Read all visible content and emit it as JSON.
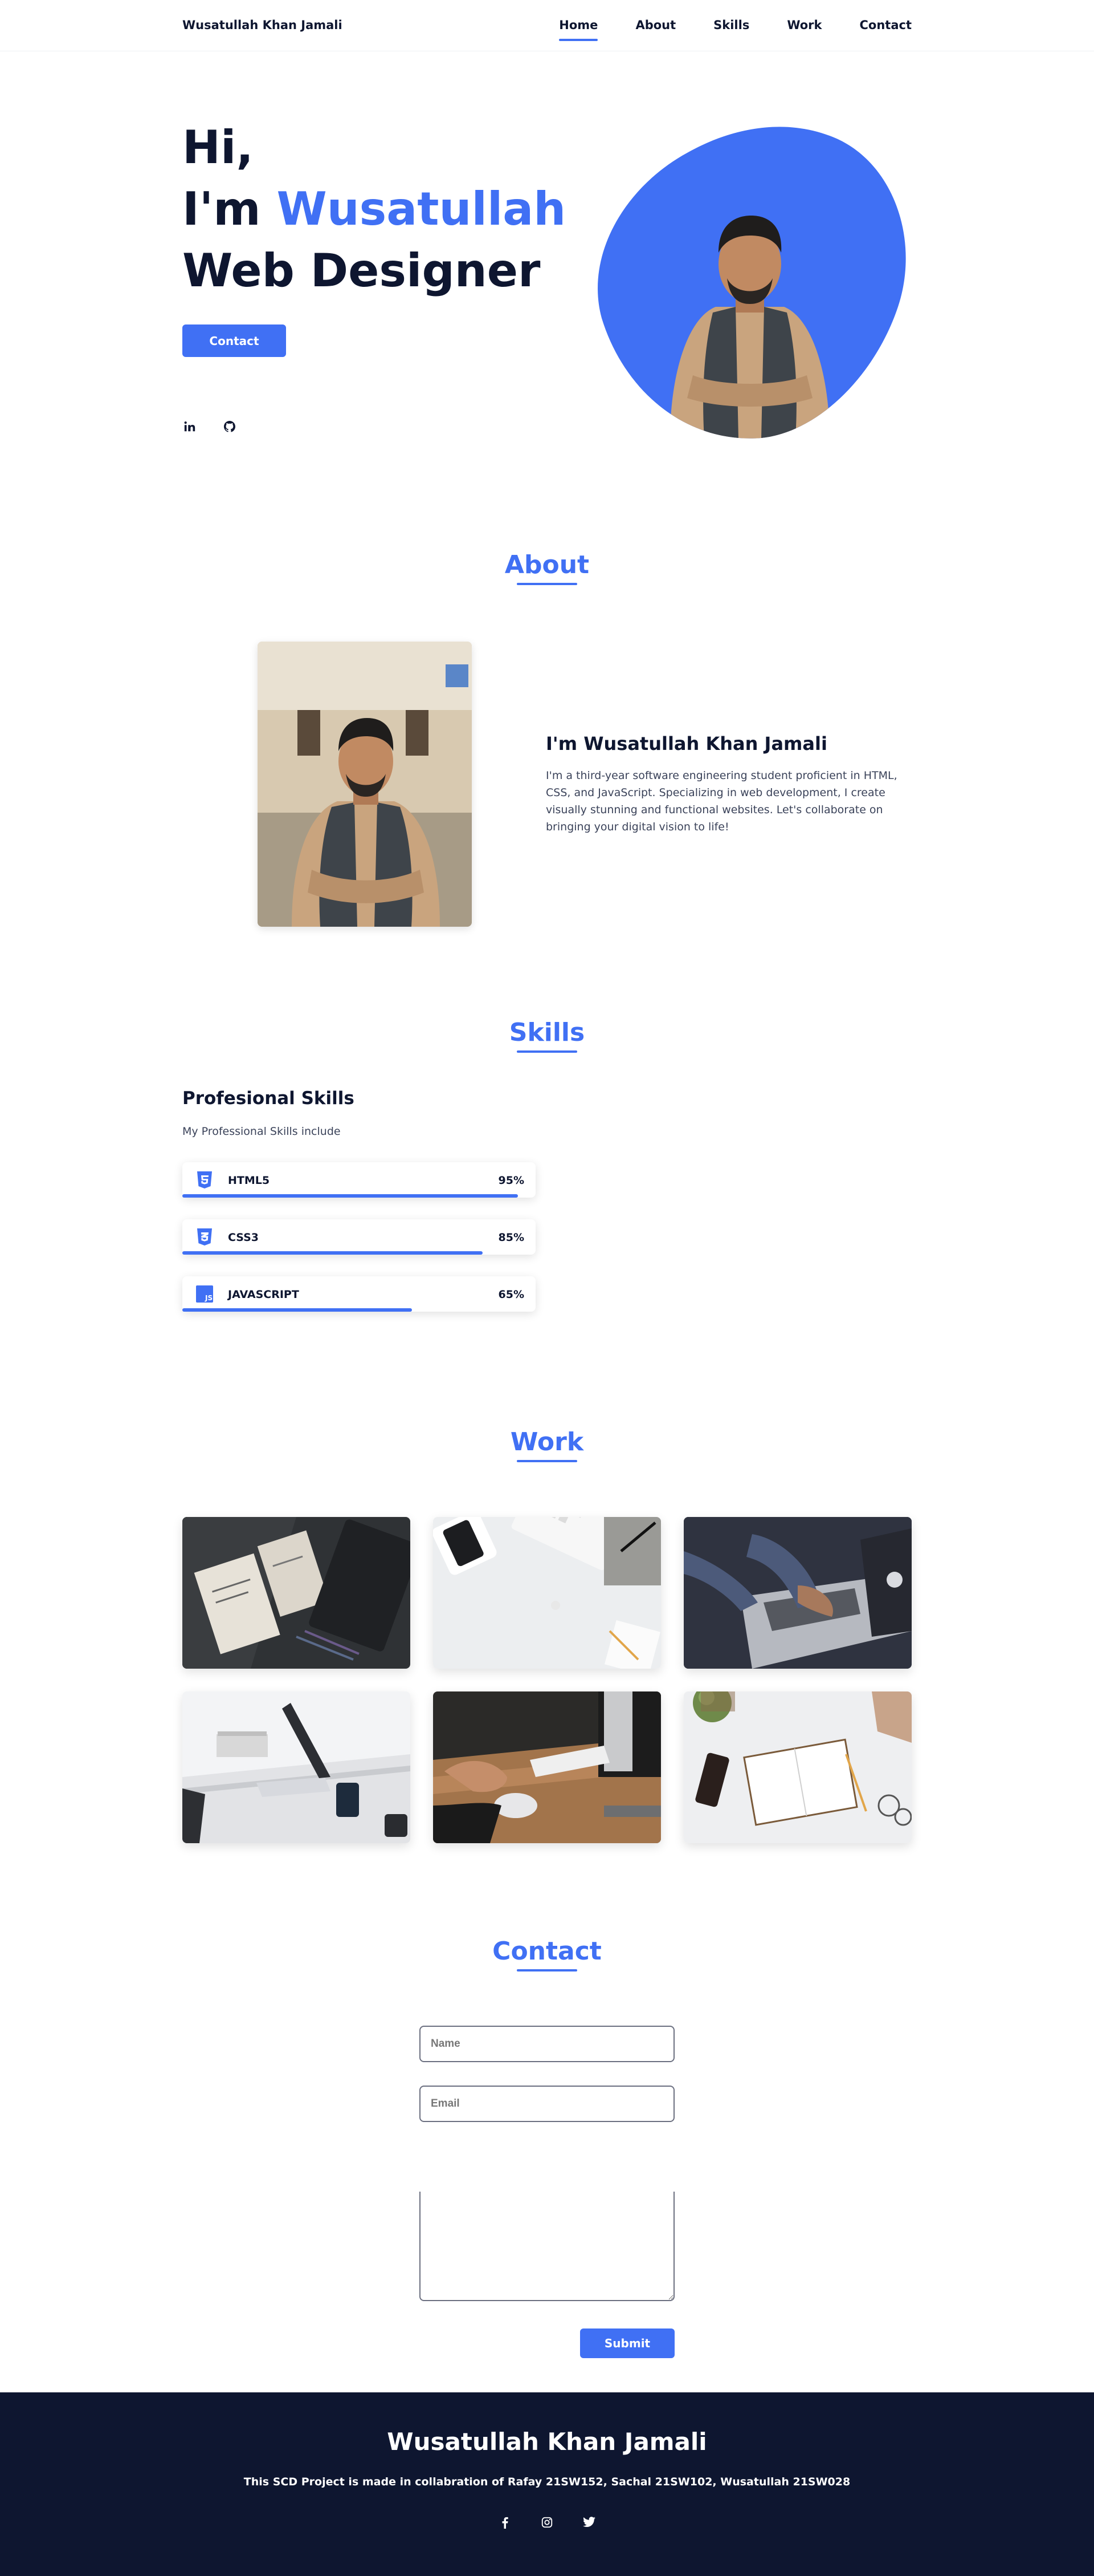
{
  "header": {
    "logo": "Wusatullah Khan Jamali",
    "nav": [
      "Home",
      "About",
      "Skills",
      "Work",
      "Contact"
    ],
    "active": "Home"
  },
  "hero": {
    "line1": "Hi,",
    "line2_prefix": "I'm ",
    "line2_name": "Wusatullah",
    "line3": "Web Designer",
    "button": "Contact",
    "social_icons": [
      "linkedin-icon",
      "github-icon"
    ]
  },
  "about": {
    "title": "About",
    "name": "I'm Wusatullah Khan Jamali",
    "text": "I'm a third-year software engineering student proficient in HTML, CSS, and JavaScript. Specializing in web development, I create visually stunning and functional websites. Let's collaborate on bringing your digital vision to life!"
  },
  "skills": {
    "title": "Skills",
    "subtitle": "Profesional Skills",
    "description": "My Professional Skills include",
    "items": [
      {
        "name": "HTML5",
        "percent": "95%",
        "level": 0.95,
        "icon": "html5-icon"
      },
      {
        "name": "CSS3",
        "percent": "85%",
        "level": 0.85,
        "icon": "css3-icon"
      },
      {
        "name": "JAVASCRIPT",
        "percent": "65%",
        "level": 0.65,
        "icon": "javascript-icon"
      }
    ]
  },
  "work": {
    "title": "Work",
    "images": [
      "desk-notes-photo",
      "workspace-keyboard-photo",
      "laptop-typing-photo",
      "desk-laptop-photo",
      "mouse-hand-photo",
      "notebook-desk-photo"
    ]
  },
  "contact": {
    "title": "Contact",
    "name_placeholder": "Name",
    "email_placeholder": "Email",
    "submit": "Submit"
  },
  "footer": {
    "title": "Wusatullah Khan Jamali",
    "text": "This SCD Project is made in collabration of Rafay 21SW152, Sachal 21SW102, Wusatullah 21SW028",
    "social_icons": [
      "facebook-icon",
      "instagram-icon",
      "twitter-icon"
    ]
  },
  "colors": {
    "accent": "#4070f4",
    "dark": "#0e1630"
  }
}
